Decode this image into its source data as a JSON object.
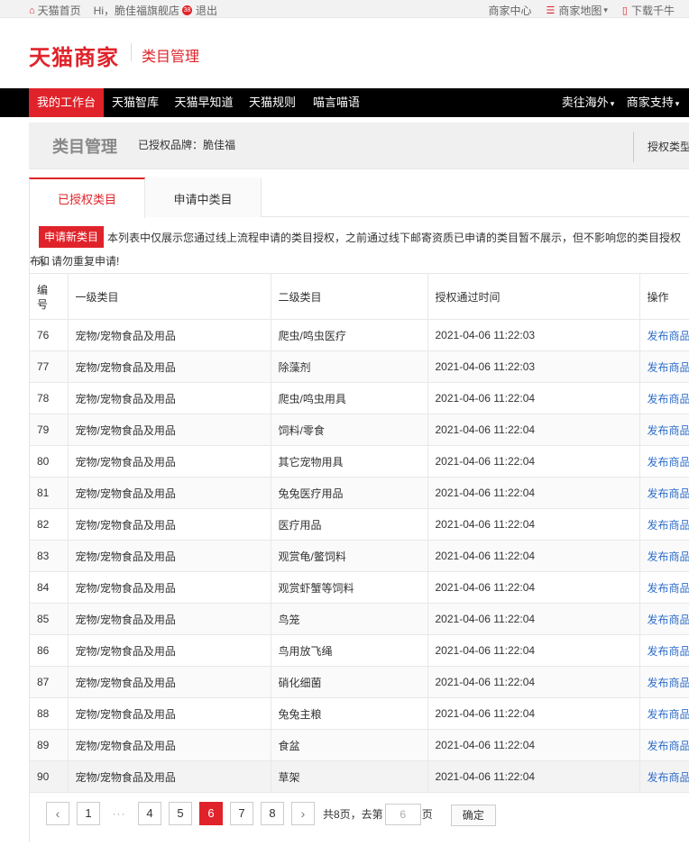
{
  "topbar": {
    "home": "天猫首页",
    "greeting": "Hi，脆佳福旗舰店",
    "badge": "38",
    "logout": "退出",
    "merchant_center": "商家中心",
    "merchant_map": "商家地图",
    "download": "下载千牛"
  },
  "header": {
    "logo": "天猫商家",
    "subtitle": "类目管理"
  },
  "nav": {
    "items": [
      "我的工作台",
      "天猫智库",
      "天猫早知道",
      "天猫规则",
      "喵言喵语"
    ],
    "right": [
      "卖往海外",
      "商家支持"
    ]
  },
  "category_head": {
    "title": "类目管理",
    "brand": "已授权品牌：脆佳福",
    "auth_type": "授权类型"
  },
  "tabs": [
    "已授权类目",
    "申请中类目"
  ],
  "notice": {
    "button": "申请新类目",
    "text1": "本列表中仅展示您通过线上流程申请的类目授权，之前通过线下邮寄资质已申请的类目暂不展示，但不影响您的类目授权和",
    "text2": "布，请勿重复申请!"
  },
  "table": {
    "headers": [
      "编号",
      "一级类目",
      "二级类目",
      "授权通过时间",
      "操作"
    ],
    "rows": [
      [
        "76",
        "宠物/宠物食品及用品",
        "爬虫/鸣虫医疗",
        "2021-04-06 11:22:03",
        "发布商品"
      ],
      [
        "77",
        "宠物/宠物食品及用品",
        "除藻剂",
        "2021-04-06 11:22:03",
        "发布商品"
      ],
      [
        "78",
        "宠物/宠物食品及用品",
        "爬虫/鸣虫用具",
        "2021-04-06 11:22:04",
        "发布商品"
      ],
      [
        "79",
        "宠物/宠物食品及用品",
        "饲料/零食",
        "2021-04-06 11:22:04",
        "发布商品"
      ],
      [
        "80",
        "宠物/宠物食品及用品",
        "其它宠物用具",
        "2021-04-06 11:22:04",
        "发布商品"
      ],
      [
        "81",
        "宠物/宠物食品及用品",
        "兔兔医疗用品",
        "2021-04-06 11:22:04",
        "发布商品"
      ],
      [
        "82",
        "宠物/宠物食品及用品",
        "医疗用品",
        "2021-04-06 11:22:04",
        "发布商品"
      ],
      [
        "83",
        "宠物/宠物食品及用品",
        "观赏龟/鳖饲料",
        "2021-04-06 11:22:04",
        "发布商品"
      ],
      [
        "84",
        "宠物/宠物食品及用品",
        "观赏虾蟹等饲料",
        "2021-04-06 11:22:04",
        "发布商品"
      ],
      [
        "85",
        "宠物/宠物食品及用品",
        "鸟笼",
        "2021-04-06 11:22:04",
        "发布商品"
      ],
      [
        "86",
        "宠物/宠物食品及用品",
        "鸟用放飞绳",
        "2021-04-06 11:22:04",
        "发布商品"
      ],
      [
        "87",
        "宠物/宠物食品及用品",
        "硝化细菌",
        "2021-04-06 11:22:04",
        "发布商品"
      ],
      [
        "88",
        "宠物/宠物食品及用品",
        "兔兔主粮",
        "2021-04-06 11:22:04",
        "发布商品"
      ],
      [
        "89",
        "宠物/宠物食品及用品",
        "食盆",
        "2021-04-06 11:22:04",
        "发布商品"
      ],
      [
        "90",
        "宠物/宠物食品及用品",
        "草架",
        "2021-04-06 11:22:04",
        "发布商品"
      ]
    ]
  },
  "pager": {
    "prev": "‹",
    "next": "›",
    "first": "1",
    "dots": "···",
    "pages": [
      "4",
      "5",
      "6",
      "7",
      "8"
    ],
    "current": "6",
    "total_text": "共8页，去第",
    "goto_value": "6",
    "page_word": "页",
    "ok": "确定"
  },
  "colors": {
    "accent": "#e0232a",
    "link": "#2f6dc9",
    "nav_bg": "#000000"
  }
}
